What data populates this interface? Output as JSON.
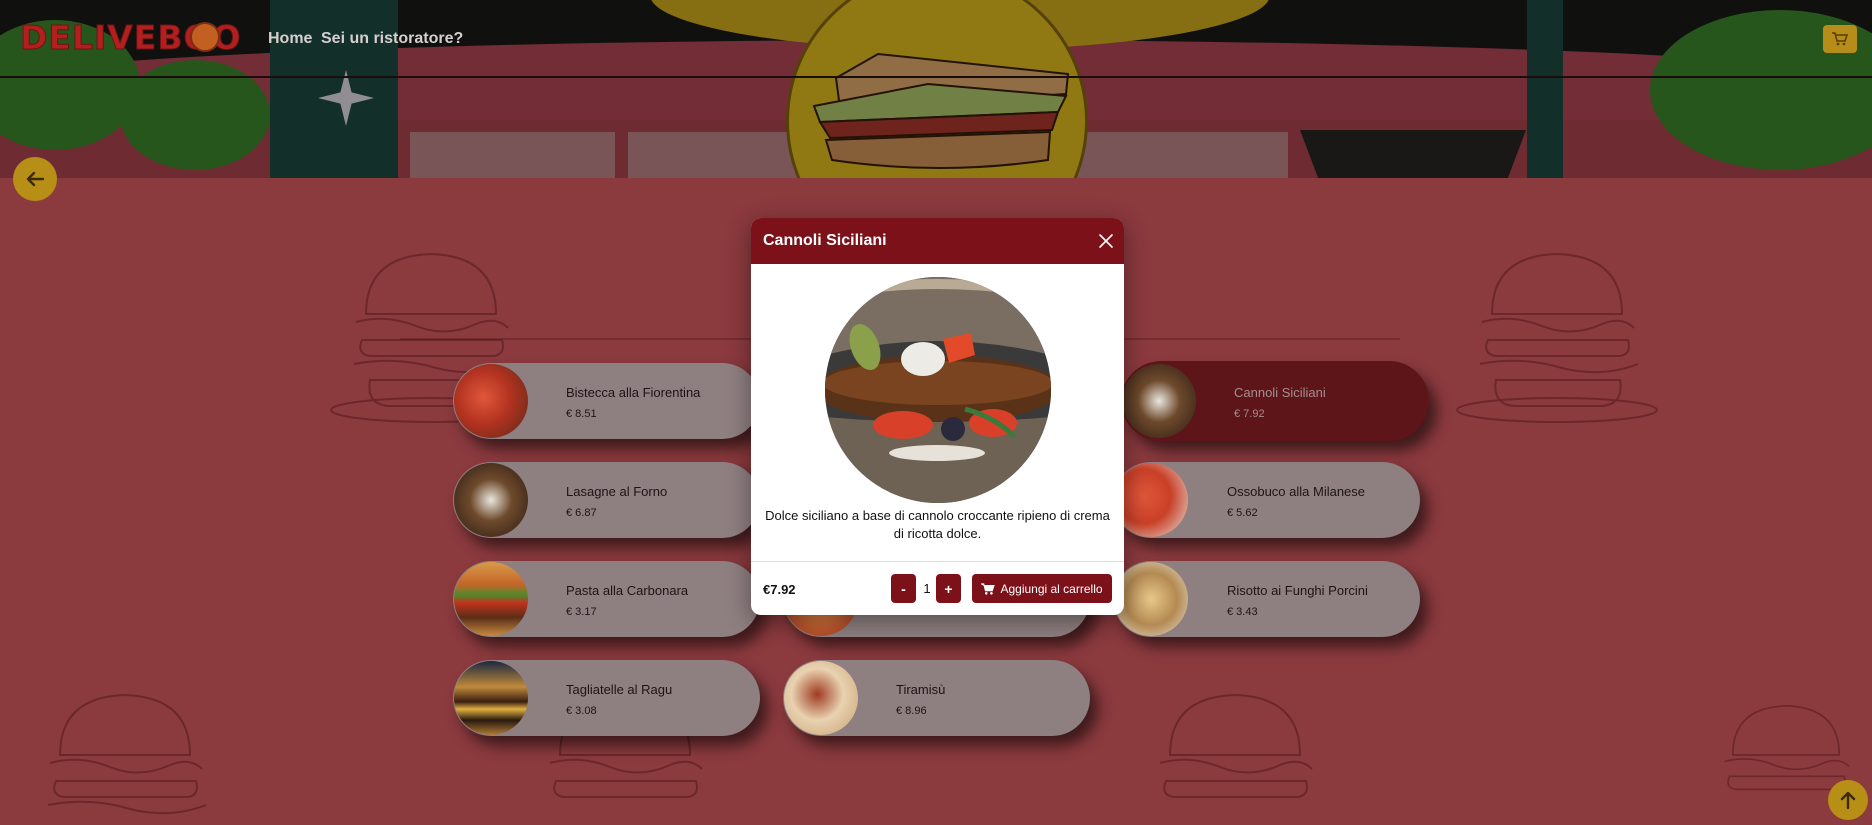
{
  "brand": {
    "logo_text": "DELIVEBOO"
  },
  "nav": {
    "home": "Home",
    "restaurateur": "Sei un ristoratore?"
  },
  "icons": {
    "cart": "cart-icon",
    "back": "arrow-left-icon",
    "scroll_top": "arrow-up-icon",
    "close": "close-icon",
    "add_to_cart": "cart-icon"
  },
  "colors": {
    "accent": "#7d1119",
    "gold": "#b88f16",
    "background": "#8b3a3e"
  },
  "dishes": [
    {
      "name": "Bistecca alla Fiorentina",
      "price": "€ 8.51"
    },
    {
      "name": "Lasagne al Forno",
      "price": "€ 6.87"
    },
    {
      "name": "Pasta alla Carbonara",
      "price": "€ 3.17"
    },
    {
      "name": "Tagliatelle al Ragu",
      "price": "€ 3.08"
    },
    {
      "name": "Tiramisù",
      "price": "€ 8.96"
    },
    {
      "name": "Cannoli Siciliani",
      "price": "€ 7.92"
    },
    {
      "name": "Ossobuco alla Milanese",
      "price": "€ 5.62"
    },
    {
      "name": "Risotto ai Funghi Porcini",
      "price": "€ 3.43"
    }
  ],
  "modal": {
    "title": "Cannoli Siciliani",
    "description": "Dolce siciliano a base di cannolo croccante ripieno di crema di ricotta dolce.",
    "price": "€7.92",
    "quantity": "1",
    "minus": "-",
    "plus": "+",
    "add_to_cart": "Aggiungi al carrello"
  }
}
